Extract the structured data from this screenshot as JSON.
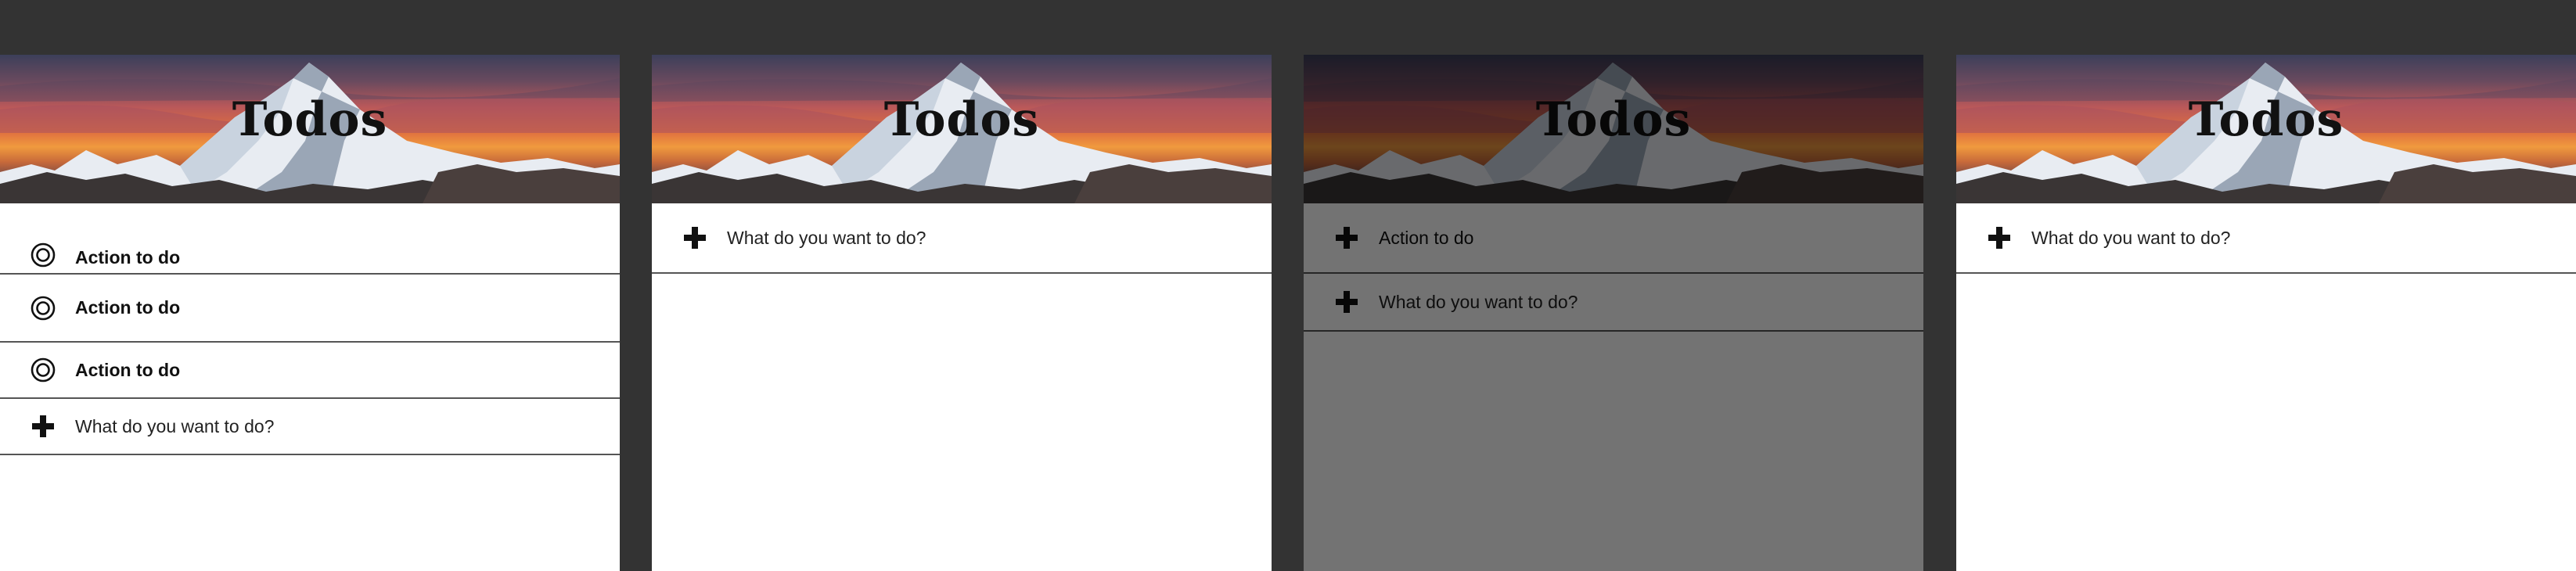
{
  "app": {
    "title": "Todos"
  },
  "panels": [
    {
      "id": "list-with-items",
      "items": [
        {
          "label": "Action to do"
        },
        {
          "label": "Action to do"
        },
        {
          "label": "Action to do"
        }
      ],
      "new_item_placeholder": "What do you want to do?"
    },
    {
      "id": "empty-list",
      "new_item_placeholder": "What do you want to do?"
    },
    {
      "id": "adding-item-dimmed",
      "pending_item": "Action to do",
      "new_item_placeholder": "What do you want to do?"
    },
    {
      "id": "empty-list-2",
      "new_item_placeholder": "What do you want to do?"
    }
  ],
  "icons": {
    "item": "circle-target-icon",
    "add": "plus-icon"
  },
  "colors": {
    "background": "#333333",
    "panel": "#ffffff",
    "divider": "#555555",
    "text": "#111111"
  }
}
